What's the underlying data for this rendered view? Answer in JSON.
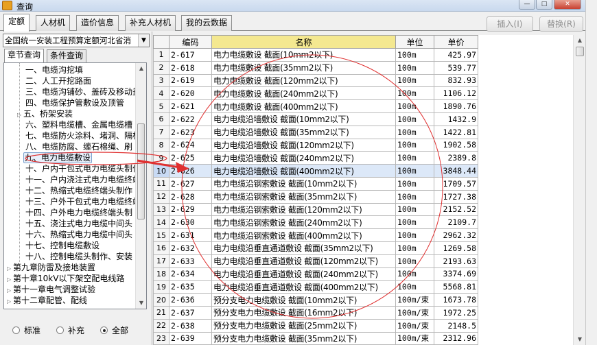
{
  "window": {
    "title": "查询"
  },
  "tabs": [
    "定额",
    "人材机",
    "造价信息",
    "补充人材机",
    "我的云数据"
  ],
  "actions": {
    "insert": "插入(I)",
    "replace": "替换(R)"
  },
  "left": {
    "library": "全国统一安装工程预算定额河北省消",
    "subtabs": [
      "章节查询",
      "条件查询"
    ],
    "tree": [
      "一、电缆沟挖填",
      "二、人工开挖路面",
      "三、电缆沟铺砂、盖砖及移动盖",
      "四、电缆保护管敷设及顶管",
      "五、桥架安装",
      "六、塑料电缆槽、金属电缆槽",
      "七、电缆防火涂料、堵洞、隔板",
      "八、电缆防腐、缠石棉绳、刷",
      "九、电力电缆敷设",
      "十、户内干包式电力电缆头制作",
      "十一、户内浇注式电力电缆终端",
      "十二、热缩式电缆终端头制作",
      "十三、户外干包式电力电缆终端",
      "十四、户外电力电缆终端头制",
      "十五、浇注式电力电缆中间头",
      "十六、热缩式电力电缆中间头",
      "十七、控制电缆敷设",
      "十八、控制电缆头制作、安装",
      "第九章防雷及接地装置",
      "第十章10kV以下架空配电线路",
      "第十一章电气调整试验",
      "第十二章配管、配线"
    ],
    "radios": [
      "标准",
      "补充",
      "全部"
    ]
  },
  "grid": {
    "headers": [
      "",
      "编码",
      "名称",
      "单位",
      "单价"
    ],
    "rows": [
      [
        "1",
        "2-617",
        "电力电缆敷设 截面(10mm2以下)",
        "100m",
        "425.97"
      ],
      [
        "2",
        "2-618",
        "电力电缆敷设 截面(35mm2以下)",
        "100m",
        "539.77"
      ],
      [
        "3",
        "2-619",
        "电力电缆敷设 截面(120mm2以下)",
        "100m",
        "832.93"
      ],
      [
        "4",
        "2-620",
        "电力电缆敷设 截面(240mm2以下)",
        "100m",
        "1106.12"
      ],
      [
        "5",
        "2-621",
        "电力电缆敷设 截面(400mm2以下)",
        "100m",
        "1890.76"
      ],
      [
        "6",
        "2-622",
        "电力电缆沿墙敷设 截面(10mm2以下)",
        "100m",
        "1432.9"
      ],
      [
        "7",
        "2-623",
        "电力电缆沿墙敷设 截面(35mm2以下)",
        "100m",
        "1422.81"
      ],
      [
        "8",
        "2-624",
        "电力电缆沿墙敷设 截面(120mm2以下)",
        "100m",
        "1902.58"
      ],
      [
        "9",
        "2-625",
        "电力电缆沿墙敷设 截面(240mm2以下)",
        "100m",
        "2389.8"
      ],
      [
        "10",
        "2-626",
        "电力电缆沿墙敷设 截面(400mm2以下)",
        "100m",
        "3848.44"
      ],
      [
        "11",
        "2-627",
        "电力电缆沿钢索敷设 截面(10mm2以下)",
        "100m",
        "1709.57"
      ],
      [
        "12",
        "2-628",
        "电力电缆沿钢索敷设 截面(35mm2以下)",
        "100m",
        "1727.38"
      ],
      [
        "13",
        "2-629",
        "电力电缆沿钢索敷设 截面(120mm2以下)",
        "100m",
        "2152.52"
      ],
      [
        "14",
        "2-630",
        "电力电缆沿钢索敷设 截面(240mm2以下)",
        "100m",
        "2109.7"
      ],
      [
        "15",
        "2-631",
        "电力电缆沿钢索敷设 截面(400mm2以下)",
        "100m",
        "2962.32"
      ],
      [
        "16",
        "2-632",
        "电力电缆沿垂直通道敷设 截面(35mm2以下)",
        "100m",
        "1269.58"
      ],
      [
        "17",
        "2-633",
        "电力电缆沿垂直通道敷设 截面(120mm2以下)",
        "100m",
        "2193.63"
      ],
      [
        "18",
        "2-634",
        "电力电缆沿垂直通道敷设 截面(240mm2以下)",
        "100m",
        "3374.69"
      ],
      [
        "19",
        "2-635",
        "电力电缆沿垂直通道敷设 截面(400mm2以下)",
        "100m",
        "5568.81"
      ],
      [
        "20",
        "2-636",
        "预分支电力电缆敷设 截面(10mm2以下)",
        "100m/束",
        "1673.78"
      ],
      [
        "21",
        "2-637",
        "预分支电力电缆敷设 截面(16mm2以下)",
        "100m/束",
        "1972.25"
      ],
      [
        "22",
        "2-638",
        "预分支电力电缆敷设 截面(25mm2以下)",
        "100m/束",
        "2148.5"
      ],
      [
        "23",
        "2-639",
        "预分支电力电缆敷设 截面(35mm2以下)",
        "100m/束",
        "2312.96"
      ]
    ]
  }
}
